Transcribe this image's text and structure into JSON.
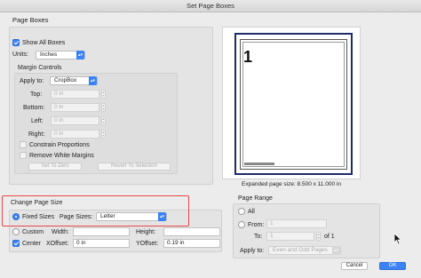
{
  "window": {
    "title": "Set Page Boxes"
  },
  "page_boxes": {
    "section_label": "Page Boxes",
    "show_all_boxes": "Show All Boxes",
    "units_label": "Units:",
    "units_value": "Inches"
  },
  "margin_controls": {
    "label": "Margin Controls",
    "apply_to_label": "Apply to:",
    "apply_to_value": "CropBox",
    "top_label": "Top:",
    "top_value": "0 in",
    "bottom_label": "Bottom:",
    "bottom_value": "0 in",
    "left_label": "Left:",
    "left_value": "0 in",
    "right_label": "Right:",
    "right_value": "0 in",
    "constrain_label": "Constrain Proportions",
    "remove_white_label": "Remove White Margins",
    "set_to_zero": "Set To Zero",
    "revert": "Revert To Selection"
  },
  "preview": {
    "page_number": "1",
    "footer_text": "Expanded page size: 8.500 x 11.000 in"
  },
  "change_page_size": {
    "label": "Change Page Size",
    "fixed_sizes": "Fixed Sizes",
    "page_sizes_label": "Page Sizes:",
    "page_sizes_value": "Letter",
    "custom": "Custom",
    "width_label": "Width:",
    "height_label": "Height:",
    "center": "Center",
    "xoffset_label": "XOffset:",
    "xoffset_value": "0 in",
    "yoffset_label": "YOffset:",
    "yoffset_value": "0.19 in"
  },
  "page_range": {
    "label": "Page Range",
    "all": "All",
    "from": "From:",
    "from_value": "1",
    "to": "To:",
    "to_value": "1",
    "of": "of 1",
    "apply_to_label": "Apply to:",
    "apply_to_value": "Even and Odd Pages"
  },
  "buttons": {
    "cancel": "Cancel",
    "ok": "OK"
  },
  "colors": {
    "accent": "#3b82f6",
    "highlight_box": "#e8474a",
    "page_border": "#1f2a6b"
  }
}
